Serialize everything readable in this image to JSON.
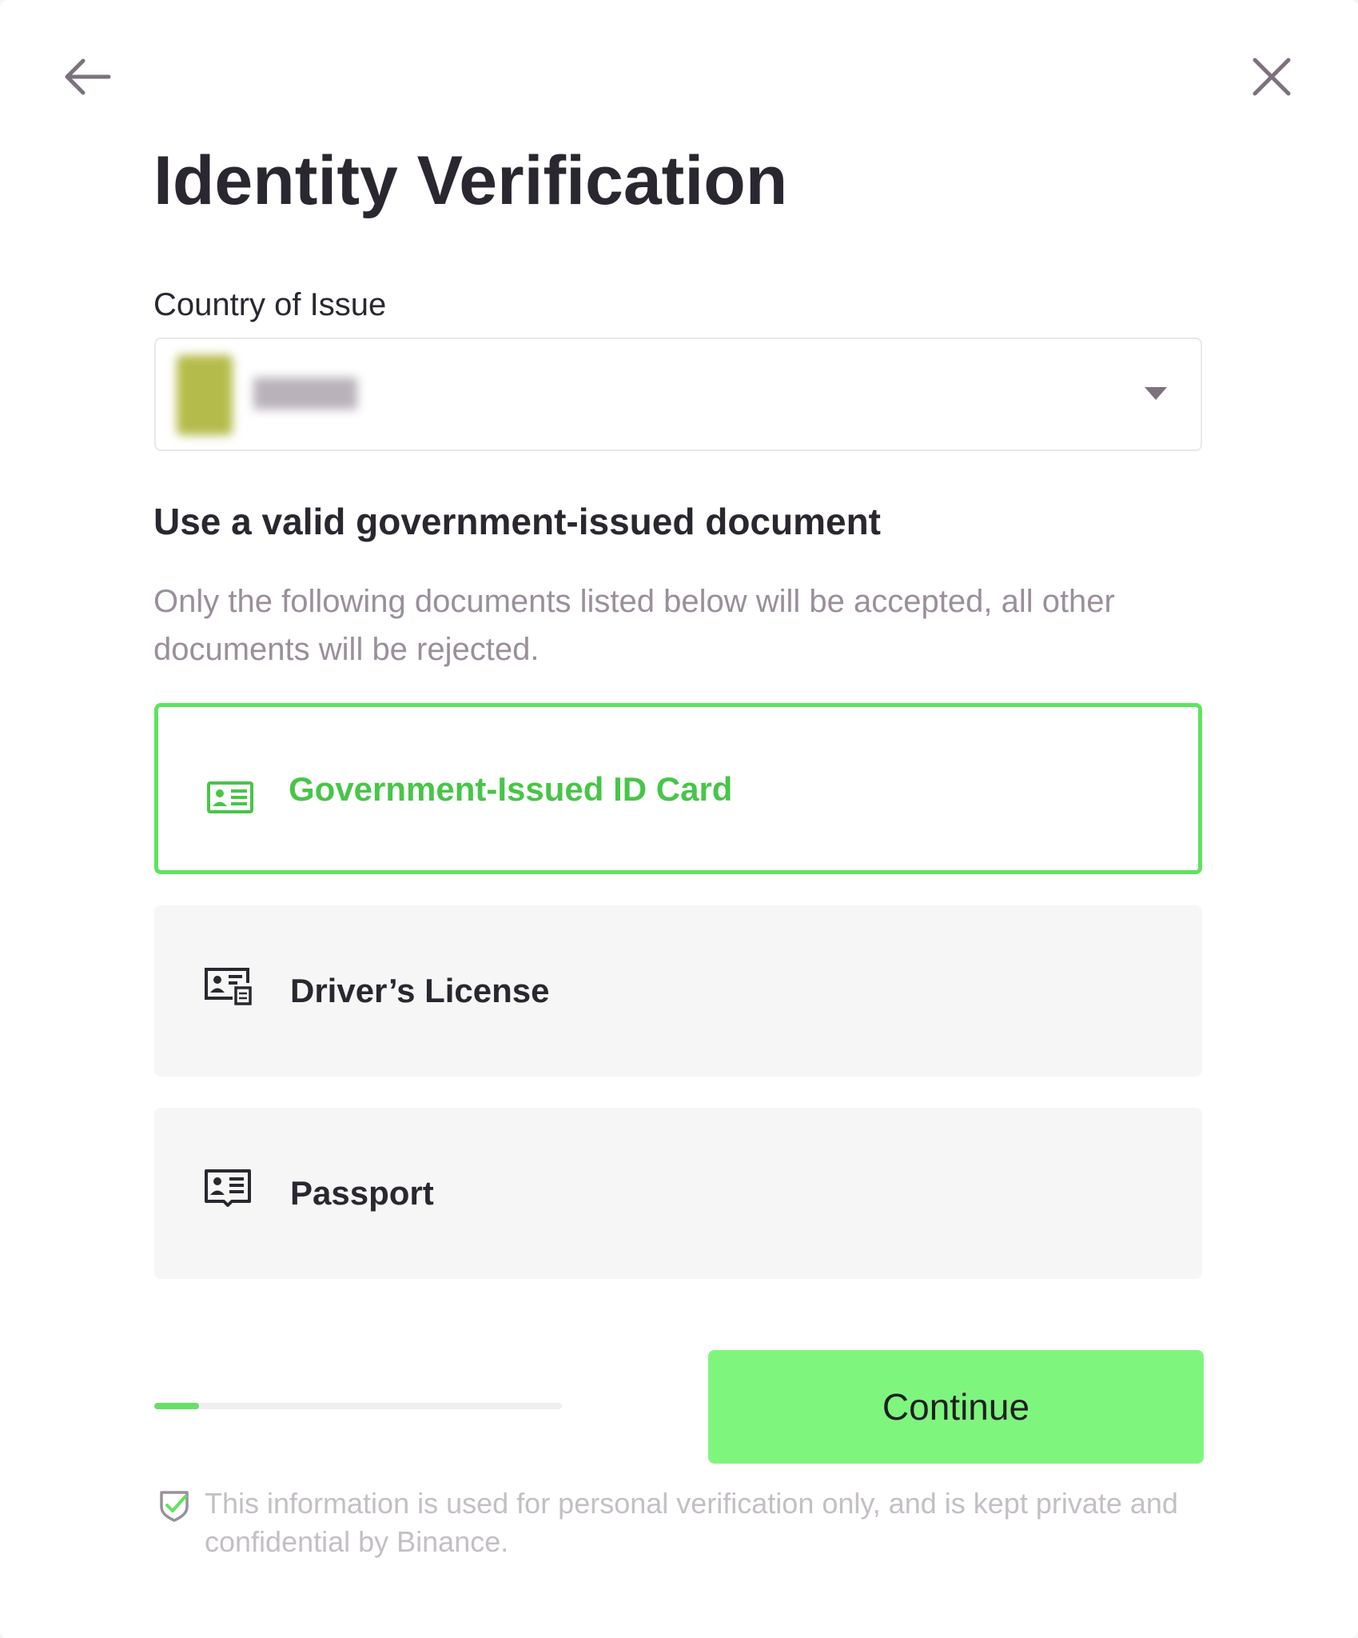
{
  "header": {
    "back_icon": "arrow-left-icon",
    "close_icon": "close-icon",
    "title": "Identity Verification"
  },
  "country": {
    "label": "Country of Issue",
    "flag_icon": "country-flag-icon",
    "caret_icon": "caret-down-icon"
  },
  "documents": {
    "heading": "Use a valid government-issued document",
    "description": "Only the following documents listed below will be accepted, all other documents will be rejected.",
    "options": [
      {
        "label": "Government-Issued ID Card",
        "icon": "id-card-icon",
        "selected": true
      },
      {
        "label": "Driver’s License",
        "icon": "drivers-license-icon",
        "selected": false
      },
      {
        "label": "Passport",
        "icon": "passport-icon",
        "selected": false
      }
    ]
  },
  "progress": {
    "fraction": 0.11
  },
  "actions": {
    "continue_label": "Continue"
  },
  "footer": {
    "privacy_icon": "shield-check-icon",
    "privacy_text": "This information is used for personal verification only, and is kept private and confidential by Binance."
  },
  "colors": {
    "accent_green": "#5ee35e",
    "selected_text_green": "#48c548",
    "button_green": "#7ef67e",
    "progress_green": "#66e066",
    "title_text": "#2b2730",
    "muted_text": "#9a8f9b",
    "icon_gray": "#7d717e"
  }
}
